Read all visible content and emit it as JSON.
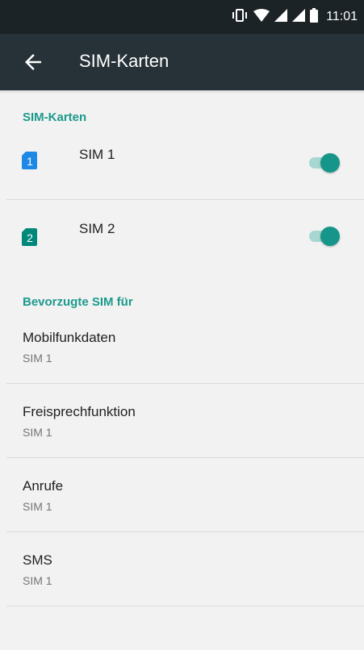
{
  "status_bar": {
    "time": "11:01",
    "icons": [
      "vibrate-icon",
      "wifi-icon",
      "signal-icon",
      "signal-icon",
      "battery-icon"
    ]
  },
  "app_bar": {
    "back_icon": "arrow-back-icon",
    "title": "SIM-Karten"
  },
  "sections": {
    "sim_cards": {
      "header": "SIM-Karten",
      "items": [
        {
          "label": "SIM 1",
          "badge": "1",
          "badge_color": "#1e88e5",
          "enabled": true
        },
        {
          "label": "SIM 2",
          "badge": "2",
          "badge_color": "#00897b",
          "enabled": true
        }
      ]
    },
    "preferred": {
      "header": "Bevorzugte SIM für",
      "items": [
        {
          "title": "Mobilfunkdaten",
          "summary": "SIM 1"
        },
        {
          "title": "Freisprechfunktion",
          "summary": "SIM 1"
        },
        {
          "title": "Anrufe",
          "summary": "SIM 1"
        },
        {
          "title": "SMS",
          "summary": "SIM 1"
        }
      ]
    }
  },
  "colors": {
    "accent": "#1a9a8c",
    "app_bar": "#263238",
    "status_bar": "#1c2326",
    "background": "#f2f2f2"
  }
}
